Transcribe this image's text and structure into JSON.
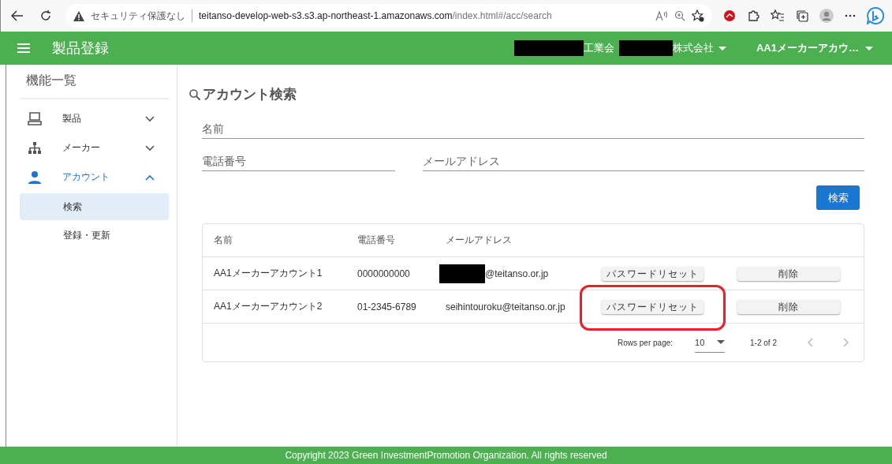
{
  "browser": {
    "security_label": "セキュリティ保護なし",
    "url_host": "teitanso-develop-web-s3.s3.ap-northeast-1.amazonaws.com",
    "url_path": "/index.html#/acc/search"
  },
  "app_bar": {
    "title": "製品登録",
    "organization": [
      "工業会",
      "株式会社"
    ],
    "account": "AA1メーカーアカウ…"
  },
  "sidebar": {
    "title": "機能一覧",
    "items": [
      {
        "kind": "monitor",
        "label": "製品",
        "expanded": false
      },
      {
        "kind": "hierarchy",
        "label": "メーカー",
        "expanded": false
      },
      {
        "kind": "person",
        "label": "アカウント",
        "expanded": true,
        "children": [
          {
            "label": "検索",
            "selected": true
          },
          {
            "label": "登録・更新",
            "selected": false
          }
        ]
      }
    ]
  },
  "search": {
    "title": "アカウント検索",
    "fields": [
      {
        "placeholder": "名前"
      },
      {
        "placeholder": "電話番号"
      },
      {
        "placeholder": "メールアドレス"
      }
    ],
    "button": "検索"
  },
  "table": {
    "columns": [
      "名前",
      "電話番号",
      "メールアドレス"
    ],
    "rows": [
      {
        "name": "AA1メーカーアカウント1",
        "phone": "0000000000",
        "email": "@teitanso.or.jp",
        "email_redacted": true,
        "reset_button": "パスワードリセット",
        "delete_button": "削除",
        "highlighted": false
      },
      {
        "name": "AA1メーカーアカウント2",
        "phone": "01-2345-6789",
        "email": "seihintouroku@teitanso.or.jp",
        "email_redacted": false,
        "reset_button": "パスワードリセット",
        "delete_button": "削除",
        "highlighted": true
      }
    ],
    "pagination": {
      "rows_per_page_label": "Rows per page:",
      "rows_per_page": "10",
      "range": "1-2 of 2",
      "prev_disabled": true,
      "next_disabled": true
    }
  },
  "footer": {
    "text": "Copyright 2023 Green InvestmentPromotion Organization. All rights reserved"
  }
}
